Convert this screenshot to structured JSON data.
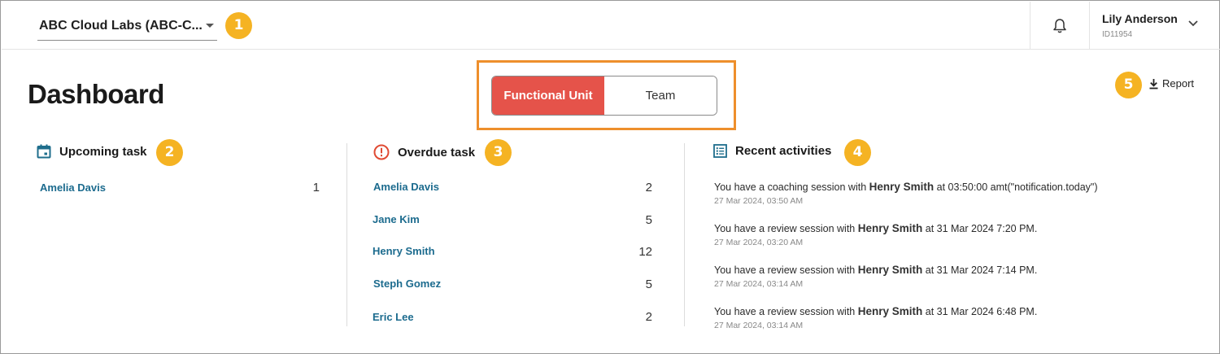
{
  "header": {
    "org_name": "ABC Cloud Labs (ABC-C...",
    "user_name": "Lily Anderson",
    "user_id": "ID11954"
  },
  "page": {
    "title": "Dashboard",
    "report_label": "Report"
  },
  "view_toggle": {
    "options": [
      "Functional Unit",
      "Team"
    ],
    "selected": "Functional Unit"
  },
  "callouts": [
    "1",
    "2",
    "3",
    "4",
    "5"
  ],
  "upcoming": {
    "heading": "Upcoming task",
    "rows": [
      {
        "name": "Amelia Davis",
        "count": "1"
      }
    ]
  },
  "overdue": {
    "heading": "Overdue task",
    "rows": [
      {
        "name": "Amelia Davis",
        "count": "2"
      },
      {
        "name": "Jane Kim",
        "count": "5"
      },
      {
        "name": "Henry Smith",
        "count": "12"
      },
      {
        "name": "Steph Gomez",
        "count": "5"
      },
      {
        "name": "Eric Lee",
        "count": "2"
      }
    ]
  },
  "activities": {
    "heading": "Recent activities",
    "items": [
      {
        "pre": "You have a coaching session with ",
        "who": "Henry Smith",
        "post": " at 03:50:00 amt(\"notification.today\")",
        "time": "27 Mar 2024, 03:50 AM"
      },
      {
        "pre": "You have a review session with ",
        "who": "Henry Smith",
        "post": " at 31 Mar 2024 7:20 PM.",
        "time": "27 Mar 2024, 03:20 AM"
      },
      {
        "pre": "You have a review session with ",
        "who": "Henry Smith",
        "post": " at 31 Mar 2024 7:14 PM.",
        "time": "27 Mar 2024, 03:14 AM"
      },
      {
        "pre": "You have a review session with ",
        "who": "Henry Smith",
        "post": " at 31 Mar 2024 6:48 PM.",
        "time": "27 Mar 2024, 03:14 AM"
      }
    ]
  },
  "colors": {
    "accent_red": "#e5534a",
    "callout_yellow": "#f5b323",
    "highlight_orange": "#ee8f2c",
    "link_blue": "#1c6b8e",
    "icon_teal": "#1f6e8c",
    "icon_red": "#e04a33"
  }
}
